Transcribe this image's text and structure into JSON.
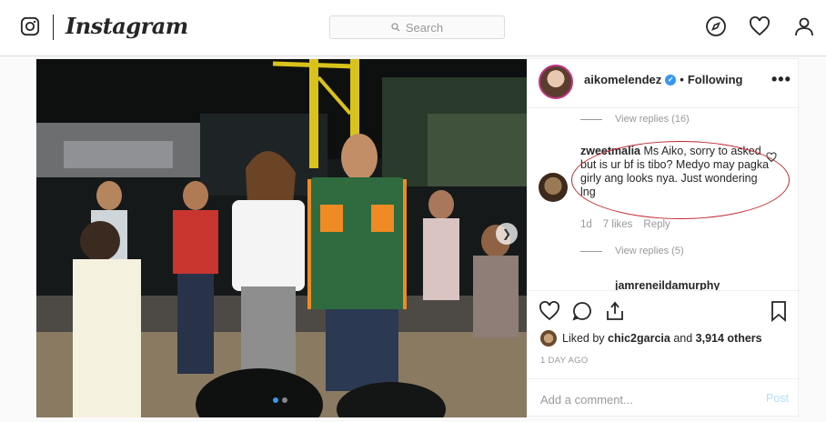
{
  "header": {
    "wordmark": "Instagram",
    "search_placeholder": "Search",
    "nav_icons": [
      "compass-icon",
      "heart-icon",
      "user-icon"
    ]
  },
  "post": {
    "author": "aikomelendez",
    "separator": "•",
    "follow_state": "Following",
    "more": "•••",
    "carousel": {
      "slides": 2,
      "current": 1
    },
    "comments": {
      "view_replies_top": "View replies (16)",
      "comment": {
        "username": "zweetmalia",
        "text": "Ms Aiko, sorry to asked but is ur bf is tibo? Medyo may pagka girly ang looks nya. Just wondering lng",
        "age": "1d",
        "likes": "7 likes",
        "reply": "Reply"
      },
      "view_replies_bottom": "View replies (5)",
      "next_username": "jamreneildamurphy"
    },
    "liked_by": {
      "prefix": "Liked by",
      "user": "chic2garcia",
      "middle": "and",
      "others": "3,914 others"
    },
    "timestamp": "1 DAY AGO",
    "add_comment_placeholder": "Add a comment...",
    "post_button": "Post"
  },
  "colors": {
    "accent": "#3897f0",
    "highlight_ellipse": "#c0282d",
    "post_disabled": "#b2dffc",
    "muted_text": "#999999"
  }
}
